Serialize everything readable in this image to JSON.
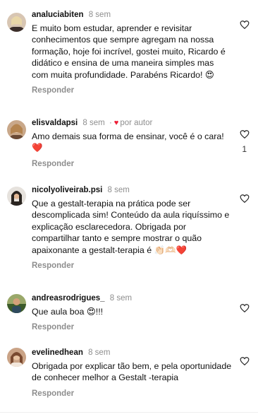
{
  "comments": [
    {
      "username": "analuciabiten",
      "time": "8 sem",
      "text": "E muito bom estudar, aprender e revisitar conhecimentos que sempre agregam na nossa formação, hoje foi incrível, gostei muito, Ricardo é didático e ensina de uma maneira simples mas com muita profundidade. Parabéns Ricardo! 😍",
      "reply_label": "Responder",
      "avatar_colors": [
        "#d8c6b3",
        "#3b2e2a"
      ]
    },
    {
      "username": "elisvaldapsi",
      "time": "8 sem",
      "author_like": "por autor",
      "text": "Amo demais sua forma de ensinar, você é  o cara!❤️",
      "reply_label": "Responder",
      "like_count": "1",
      "avatar_colors": [
        "#c9a88a",
        "#6a4a35"
      ]
    },
    {
      "username": "nicolyoliveirab.psi",
      "time": "8 sem",
      "text": "Que a gestalt-terapia na prática pode ser descomplicada sim! Conteúdo da aula riquíssimo e explicação esclarecedora. Obrigada por compartilhar tanto e sempre mostrar o quão apaixonante a gestalt-terapia é 👏🏻🫶🏻❤️",
      "reply_label": "Responder",
      "avatar_colors": [
        "#e6e2dd",
        "#2a2420"
      ]
    },
    {
      "username": "andreasrodrigues_",
      "time": "8 sem",
      "text": "Que aula boa 😍!!!",
      "reply_label": "Responder",
      "avatar_colors": [
        "#9aa86a",
        "#3c5b2a"
      ]
    },
    {
      "username": "evelinedhean",
      "time": "8 sem",
      "text": "Obrigada por explicar tão bem, e pela oportunidade de conhecer melhor a Gestalt -terapia",
      "reply_label": "Responder",
      "avatar_colors": [
        "#caa386",
        "#7a4a30"
      ]
    }
  ],
  "colors": {
    "muted": "#8e8e8e",
    "heart": "#ed1d35"
  }
}
